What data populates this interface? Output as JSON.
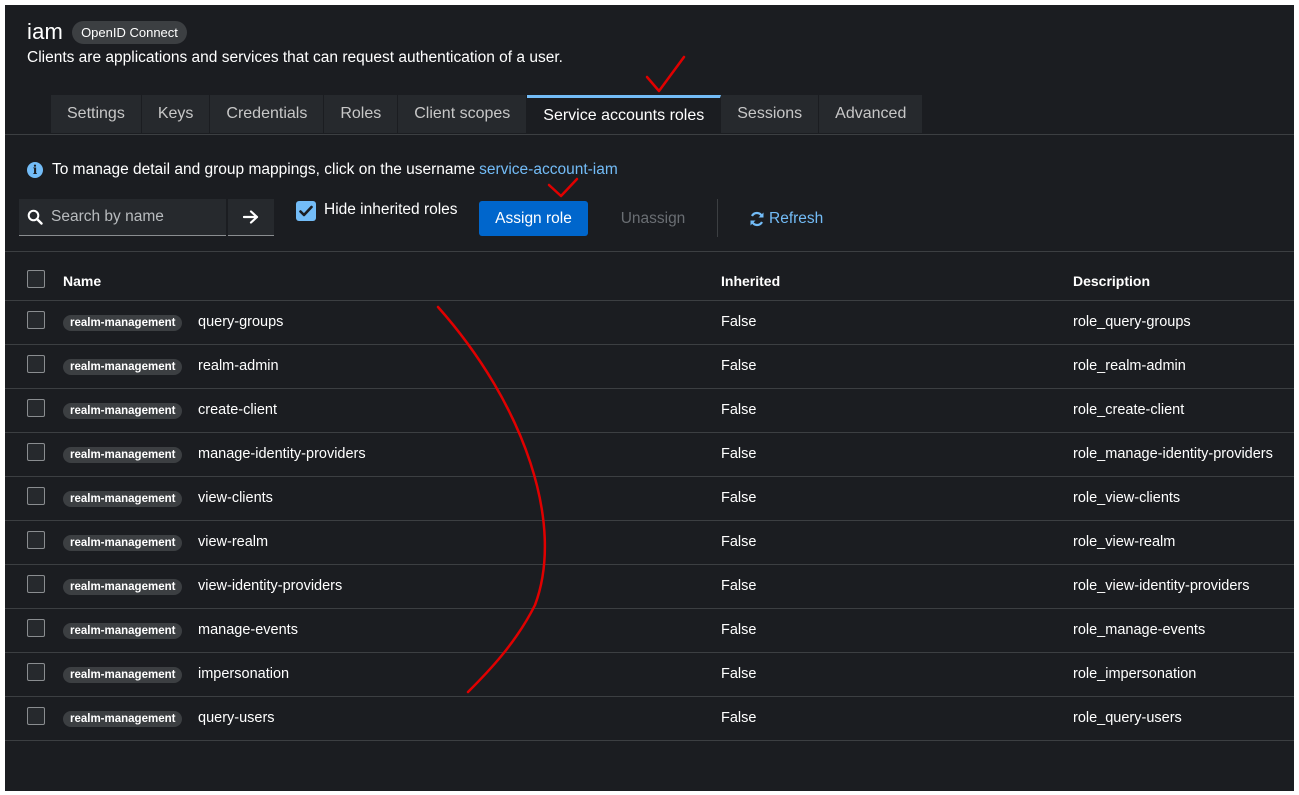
{
  "header": {
    "app_title": "iam",
    "protocol_badge": "OpenID Connect",
    "subtitle": "Clients are applications and services that can request authentication of a user."
  },
  "tabs": [
    {
      "label": "Settings",
      "active": false
    },
    {
      "label": "Keys",
      "active": false
    },
    {
      "label": "Credentials",
      "active": false
    },
    {
      "label": "Roles",
      "active": false
    },
    {
      "label": "Client scopes",
      "active": false
    },
    {
      "label": "Service accounts roles",
      "active": true
    },
    {
      "label": "Sessions",
      "active": false
    },
    {
      "label": "Advanced",
      "active": false
    }
  ],
  "info": {
    "icon": "info-circle-icon",
    "text": "To manage detail and group mappings, click on the username",
    "link": "service-account-iam"
  },
  "toolbar": {
    "search_placeholder": "Search by name",
    "hide_inherited_label": "Hide inherited roles",
    "hide_inherited_checked": true,
    "assign_label": "Assign role",
    "unassign_label": "Unassign",
    "refresh_label": "Refresh"
  },
  "table": {
    "headers": {
      "name": "Name",
      "inherited": "Inherited",
      "description": "Description"
    },
    "rows": [
      {
        "client": "realm-management",
        "name": "query-groups",
        "inherited": "False",
        "description": "role_query-groups"
      },
      {
        "client": "realm-management",
        "name": "realm-admin",
        "inherited": "False",
        "description": "role_realm-admin"
      },
      {
        "client": "realm-management",
        "name": "create-client",
        "inherited": "False",
        "description": "role_create-client"
      },
      {
        "client": "realm-management",
        "name": "manage-identity-providers",
        "inherited": "False",
        "description": "role_manage-identity-providers"
      },
      {
        "client": "realm-management",
        "name": "view-clients",
        "inherited": "False",
        "description": "role_view-clients"
      },
      {
        "client": "realm-management",
        "name": "view-realm",
        "inherited": "False",
        "description": "role_view-realm"
      },
      {
        "client": "realm-management",
        "name": "view-identity-providers",
        "inherited": "False",
        "description": "role_view-identity-providers"
      },
      {
        "client": "realm-management",
        "name": "manage-events",
        "inherited": "False",
        "description": "role_manage-events"
      },
      {
        "client": "realm-management",
        "name": "impersonation",
        "inherited": "False",
        "description": "role_impersonation"
      },
      {
        "client": "realm-management",
        "name": "query-users",
        "inherited": "False",
        "description": "role_query-users"
      }
    ]
  },
  "colors": {
    "background": "#1b1d21",
    "accent": "#73bcf7",
    "primary_button": "#0066cc",
    "annotation": "#e00000"
  }
}
